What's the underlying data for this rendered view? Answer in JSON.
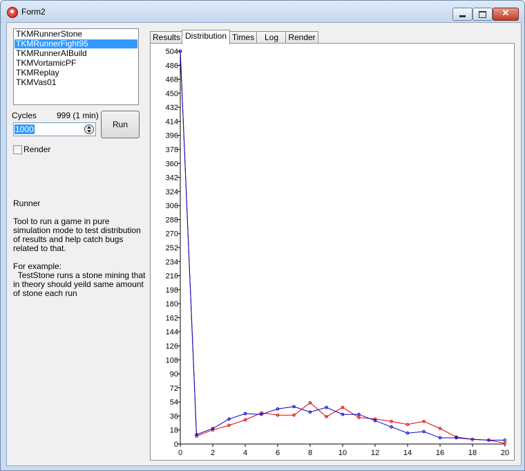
{
  "window": {
    "title": "Form2"
  },
  "runners": [
    {
      "label": "TKMRunnerStone",
      "selected": false
    },
    {
      "label": "TKMRunnerFight95",
      "selected": true
    },
    {
      "label": "TKMRunnerAIBuild",
      "selected": false
    },
    {
      "label": "TKMVortamicPF",
      "selected": false
    },
    {
      "label": "TKMReplay",
      "selected": false
    },
    {
      "label": "TKMVas01",
      "selected": false
    }
  ],
  "cycles": {
    "label": "Cycles",
    "info": "999 (1 min)",
    "value": "1000"
  },
  "run_button": "Run",
  "render_checkbox": {
    "label": "Render",
    "checked": false
  },
  "description": {
    "heading": "Runner",
    "para1": "Tool to run a game in pure simulation mode to test distribution of results and help catch bugs related to that.",
    "para2_line1": "For example:",
    "para2_line2": "  TestStone runs a stone mining that in theory should yeild same amount of stone each run"
  },
  "tabs": [
    {
      "label": "Results",
      "active": false
    },
    {
      "label": "Distribution",
      "active": true
    },
    {
      "label": "Times",
      "active": false
    },
    {
      "label": "Log",
      "active": false
    },
    {
      "label": "Render",
      "active": false
    }
  ],
  "colors": {
    "series_red": "#e00000",
    "series_blue": "#0000c8",
    "selection": "#3399ff"
  },
  "chart_data": {
    "type": "line",
    "xlim": [
      0,
      20
    ],
    "ylim": [
      0,
      504
    ],
    "x_ticks": [
      0,
      2,
      4,
      6,
      8,
      10,
      12,
      14,
      16,
      18,
      20
    ],
    "y_ticks": [
      0,
      18,
      36,
      54,
      72,
      90,
      108,
      126,
      144,
      162,
      180,
      198,
      216,
      234,
      252,
      270,
      288,
      306,
      324,
      342,
      360,
      378,
      396,
      414,
      432,
      450,
      468,
      486,
      504
    ],
    "series": [
      {
        "color": "#e00000",
        "x": [
          0,
          1,
          2,
          3,
          4,
          5,
          6,
          7,
          8,
          9,
          10,
          11,
          12,
          13,
          14,
          15,
          16,
          17,
          18,
          19,
          20
        ],
        "y": [
          504,
          10,
          18,
          24,
          31,
          40,
          37,
          37,
          53,
          35,
          47,
          34,
          32,
          29,
          25,
          29,
          20,
          9,
          6,
          5,
          1
        ]
      },
      {
        "color": "#0000c8",
        "x": [
          0,
          1,
          2,
          3,
          4,
          5,
          6,
          7,
          8,
          9,
          10,
          11,
          12,
          13,
          14,
          15,
          16,
          17,
          18,
          19,
          20
        ],
        "y": [
          504,
          12,
          20,
          32,
          39,
          38,
          45,
          48,
          41,
          47,
          38,
          38,
          30,
          22,
          14,
          16,
          8,
          8,
          6,
          5,
          5
        ]
      }
    ]
  }
}
